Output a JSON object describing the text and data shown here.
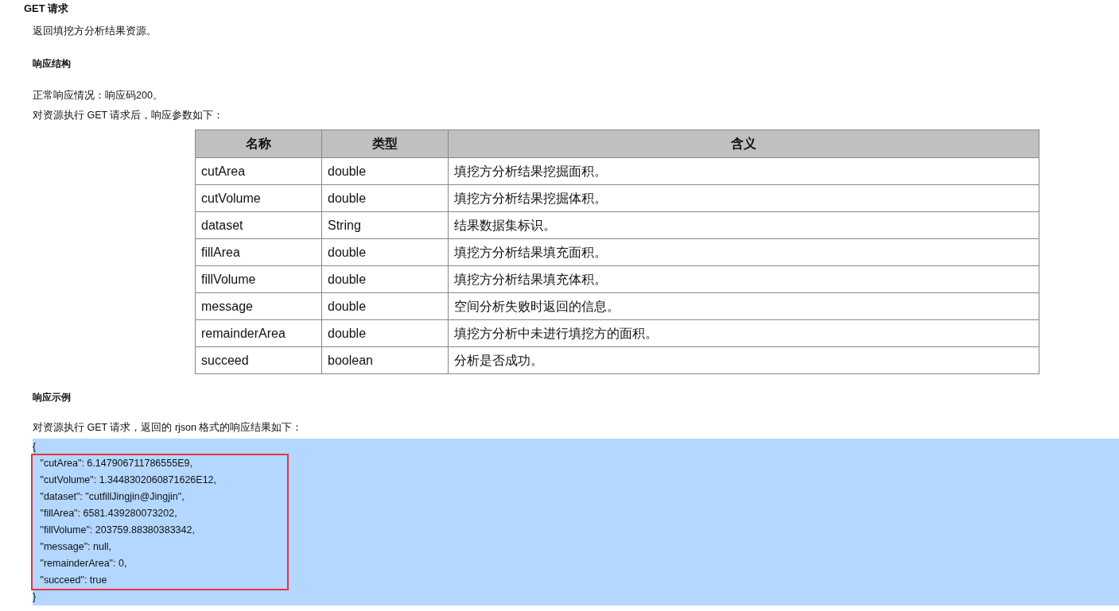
{
  "title": "GET 请求",
  "description": "返回填挖方分析结果资源。",
  "response_structure": {
    "heading": "响应结构",
    "lines": [
      "正常响应情况：响应码200。",
      "对资源执行 GET 请求后，响应参数如下："
    ]
  },
  "table": {
    "columns": [
      "名称",
      "类型",
      "含义"
    ],
    "rows": [
      [
        "cutArea",
        "double",
        "填挖方分析结果挖掘面积。"
      ],
      [
        "cutVolume",
        "double",
        "填挖方分析结果挖掘体积。"
      ],
      [
        "dataset",
        "String",
        "结果数据集标识。"
      ],
      [
        "fillArea",
        "double",
        "填挖方分析结果填充面积。"
      ],
      [
        "fillVolume",
        "double",
        "填挖方分析结果填充体积。"
      ],
      [
        "message",
        "double",
        "空间分析失败时返回的信息。"
      ],
      [
        "remainderArea",
        "double",
        "填挖方分析中未进行填挖方的面积。"
      ],
      [
        "succeed",
        "boolean",
        "分析是否成功。"
      ]
    ]
  },
  "response_example": {
    "heading": "响应示例",
    "intro": "对资源执行 GET 请求，返回的 rjson 格式的响应结果如下：",
    "code": {
      "opening": "{",
      "boxed_lines": [
        " \"cutArea\": 6.147906711786555E9,",
        " \"cutVolume\": 1.3448302060871626E12,",
        " \"dataset\": \"cutfillJingjin@Jingjin\",",
        " \"fillArea\": 6581.439280073202,",
        " \"fillVolume\": 203759.88380383342,",
        " \"message\": null,",
        " \"remainderArea\": 0,",
        " \"succeed\": true"
      ],
      "closing": "}"
    }
  }
}
